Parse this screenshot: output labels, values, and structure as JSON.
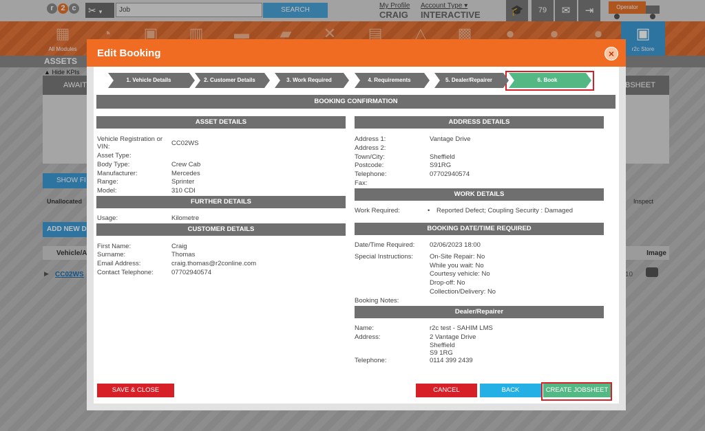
{
  "app": {
    "logo_letters": [
      "r",
      "2",
      "c"
    ],
    "search_value": "Job",
    "search_button": "SEARCH",
    "profile_link": "My Profile",
    "profile_name": "CRAIG",
    "account_link": "Account Type",
    "account_value": "INTERACTIVE",
    "badge_count": "79",
    "operator_label": "Operator",
    "nav": [
      {
        "label": "All Modules",
        "icon": "grid-icon"
      },
      {
        "label": "",
        "icon": "speedometer-icon"
      },
      {
        "label": "",
        "icon": "calendar-icon"
      },
      {
        "label": "",
        "icon": "buildings-icon"
      },
      {
        "label": "",
        "icon": "folder-icon"
      },
      {
        "label": "",
        "icon": "truck-icon"
      },
      {
        "label": "",
        "icon": "tools-icon"
      },
      {
        "label": "",
        "icon": "clipboard-icon"
      },
      {
        "label": "",
        "icon": "warning-icon"
      },
      {
        "label": "",
        "icon": "contact-icon"
      },
      {
        "label": "",
        "icon": "settings-icon"
      },
      {
        "label": "",
        "icon": "driver-icon"
      },
      {
        "label": "",
        "icon": "i2i-icon"
      },
      {
        "label": "r2c Store",
        "icon": "briefcase-icon"
      }
    ],
    "page_title": "ASSETS",
    "hide_kpis": "Hide KPIs",
    "panel_left": "AWAIT",
    "panel_right": "JOBSHEET",
    "show_filters": "SHOW FI",
    "unallocated": "Unallocated",
    "inspect": "Inspect",
    "add_new": "ADD NEW D",
    "table_col_vehicle": "Vehicle/A",
    "table_col_image": "Image",
    "row_link": "CC02WS",
    "row_num": "10"
  },
  "modal": {
    "title": "Edit Booking",
    "steps": [
      "1. Vehicle Details",
      "2. Customer Details",
      "3. Work Required",
      "4. Requirements",
      "5. Dealer/Repairer",
      "6. Book"
    ],
    "booking_confirmation": "BOOKING CONFIRMATION",
    "asset_details": {
      "title": "ASSET DETAILS",
      "rows": [
        {
          "k": "Vehicle Registration or VIN:",
          "v": "CC02WS"
        },
        {
          "k": "Asset Type:",
          "v": ""
        },
        {
          "k": "Body Type:",
          "v": "Crew Cab"
        },
        {
          "k": "Manufacturer:",
          "v": "Mercedes"
        },
        {
          "k": "Range:",
          "v": "Sprinter"
        },
        {
          "k": "Model:",
          "v": "310 CDI"
        }
      ]
    },
    "further_details": {
      "title": "FURTHER DETAILS",
      "rows": [
        {
          "k": "Usage:",
          "v": "Kilometre"
        }
      ]
    },
    "customer_details": {
      "title": "CUSTOMER DETAILS",
      "rows": [
        {
          "k": "First Name:",
          "v": "Craig"
        },
        {
          "k": "Surname:",
          "v": "Thomas"
        },
        {
          "k": "Email Address:",
          "v": "craig.thomas@r2conline.com"
        },
        {
          "k": "Contact Telephone:",
          "v": "07702940574"
        }
      ]
    },
    "address_details": {
      "title": "ADDRESS DETAILS",
      "rows": [
        {
          "k": "Address 1:",
          "v": "Vantage Drive"
        },
        {
          "k": "Address 2:",
          "v": ""
        },
        {
          "k": "Town/City:",
          "v": "Sheffield"
        },
        {
          "k": "Postcode:",
          "v": "S91RG"
        },
        {
          "k": "Telephone:",
          "v": "07702940574"
        },
        {
          "k": "Fax:",
          "v": ""
        }
      ]
    },
    "work_details": {
      "title": "WORK DETAILS",
      "label": "Work Required:",
      "items": [
        "Reported Defect; Coupling Security : Damaged"
      ]
    },
    "booking_datetime": {
      "title": "BOOKING DATE/TIME REQUIRED",
      "date_label": "Date/Time Required:",
      "date_value": "02/06/2023 18:00",
      "special_label": "Special Instructions:",
      "special_items": [
        "On-Site Repair: No",
        "While you wait: No",
        "Courtesy vehicle: No",
        "Drop-off: No",
        "Collection/Delivery: No"
      ],
      "notes_label": "Booking Notes:"
    },
    "dealer": {
      "title": "Dealer/Repairer",
      "name_label": "Name:",
      "name_value": "r2c test - SAHIM LMS",
      "address_label": "Address:",
      "address_lines": [
        "2 Vantage Drive",
        "Sheffield",
        "S9 1RG"
      ],
      "telephone_label": "Telephone:",
      "telephone_value": "0114 399 2439"
    },
    "buttons": {
      "save_close": "SAVE & CLOSE",
      "cancel": "CANCEL",
      "back": "BACK",
      "create": "CREATE JOBSHEET"
    }
  },
  "colors": {
    "brand_orange": "#ef6c22",
    "step_grey": "#6f6f6f",
    "step_active": "#54b885",
    "danger": "#d61f26",
    "info": "#25b0e5"
  }
}
